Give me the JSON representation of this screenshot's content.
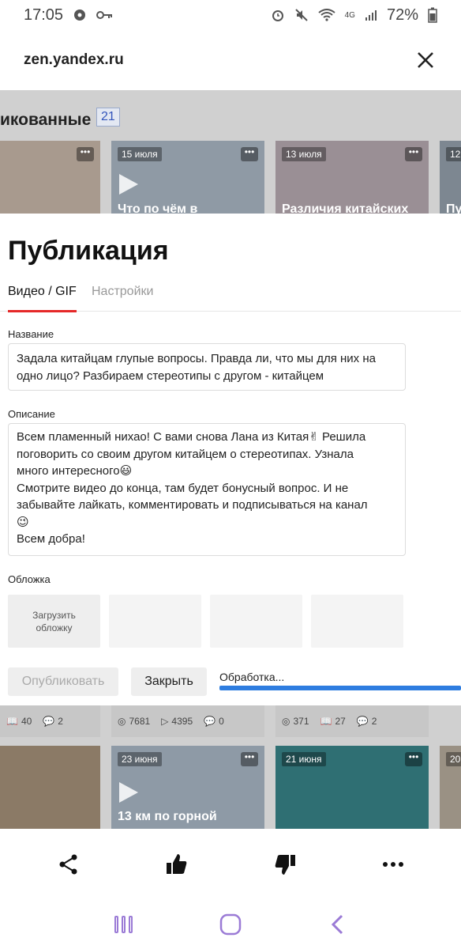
{
  "status_bar": {
    "time": "17:05",
    "network": "4G",
    "battery": "72%",
    "icons": [
      "gear-icon",
      "key-icon",
      "alarm-icon",
      "mute-icon",
      "wifi-icon",
      "signal-icon",
      "battery-icon"
    ]
  },
  "browser": {
    "url": "zen.yandex.ru",
    "close_icon": "close-icon"
  },
  "background": {
    "section_title": "икованные",
    "section_count": "21",
    "thumbs_top": [
      {
        "date": "",
        "caption": ""
      },
      {
        "date": "15 июля",
        "caption": "Что по чём в"
      },
      {
        "date": "13 июля",
        "caption": "Различия китайских"
      },
      {
        "date": "12",
        "caption": "Пу"
      }
    ],
    "stats": [
      [
        {
          "icon": "book-icon",
          "value": "40"
        },
        {
          "icon": "comment-icon",
          "value": "2"
        }
      ],
      [
        {
          "icon": "eye-icon",
          "value": "7681"
        },
        {
          "icon": "play-icon",
          "value": "4395"
        },
        {
          "icon": "comment-icon",
          "value": "0"
        }
      ],
      [
        {
          "icon": "eye-icon",
          "value": "371"
        },
        {
          "icon": "book-icon",
          "value": "27"
        },
        {
          "icon": "comment-icon",
          "value": "2"
        }
      ]
    ],
    "thumbs_bottom": [
      {
        "date": "",
        "caption": ""
      },
      {
        "date": "23 июня",
        "caption": "13 км по горной"
      },
      {
        "date": "21 июня",
        "caption": ""
      },
      {
        "date": "20",
        "caption": ""
      }
    ]
  },
  "modal": {
    "title": "Публикация",
    "tabs": [
      {
        "label": "Видео / GIF",
        "active": true
      },
      {
        "label": "Настройки",
        "active": false
      }
    ],
    "name_label": "Название",
    "name_value": "Задала китайцам глупые вопросы. Правда ли, что мы для них на одно лицо? Разбираем стереотипы с другом - китайцем",
    "description_label": "Описание",
    "description_lines": [
      "Всем пламенный нихао! С вами снова Лана из Китая✌ Решила",
      "поговорить со своим другом китайцем о стереотипах. Узнала",
      "много интересного😃",
      "Смотрите видео до конца, там будет бонусный вопрос. И не",
      "забывайте лайкать, комментировать и подписываться на канал",
      "😉",
      "Всем добра!"
    ],
    "cover_label": "Обложка",
    "cover_upload": "Загрузить обложку",
    "publish_button": "Опубликовать",
    "close_button": "Закрыть",
    "processing_label": "Обработка...",
    "progress": 1.0
  },
  "toolbar": {
    "icons": [
      "share-icon",
      "like-icon",
      "dislike-icon",
      "more-icon"
    ]
  },
  "nav": {
    "icons": [
      "recent-apps-icon",
      "home-icon",
      "back-icon"
    ]
  }
}
